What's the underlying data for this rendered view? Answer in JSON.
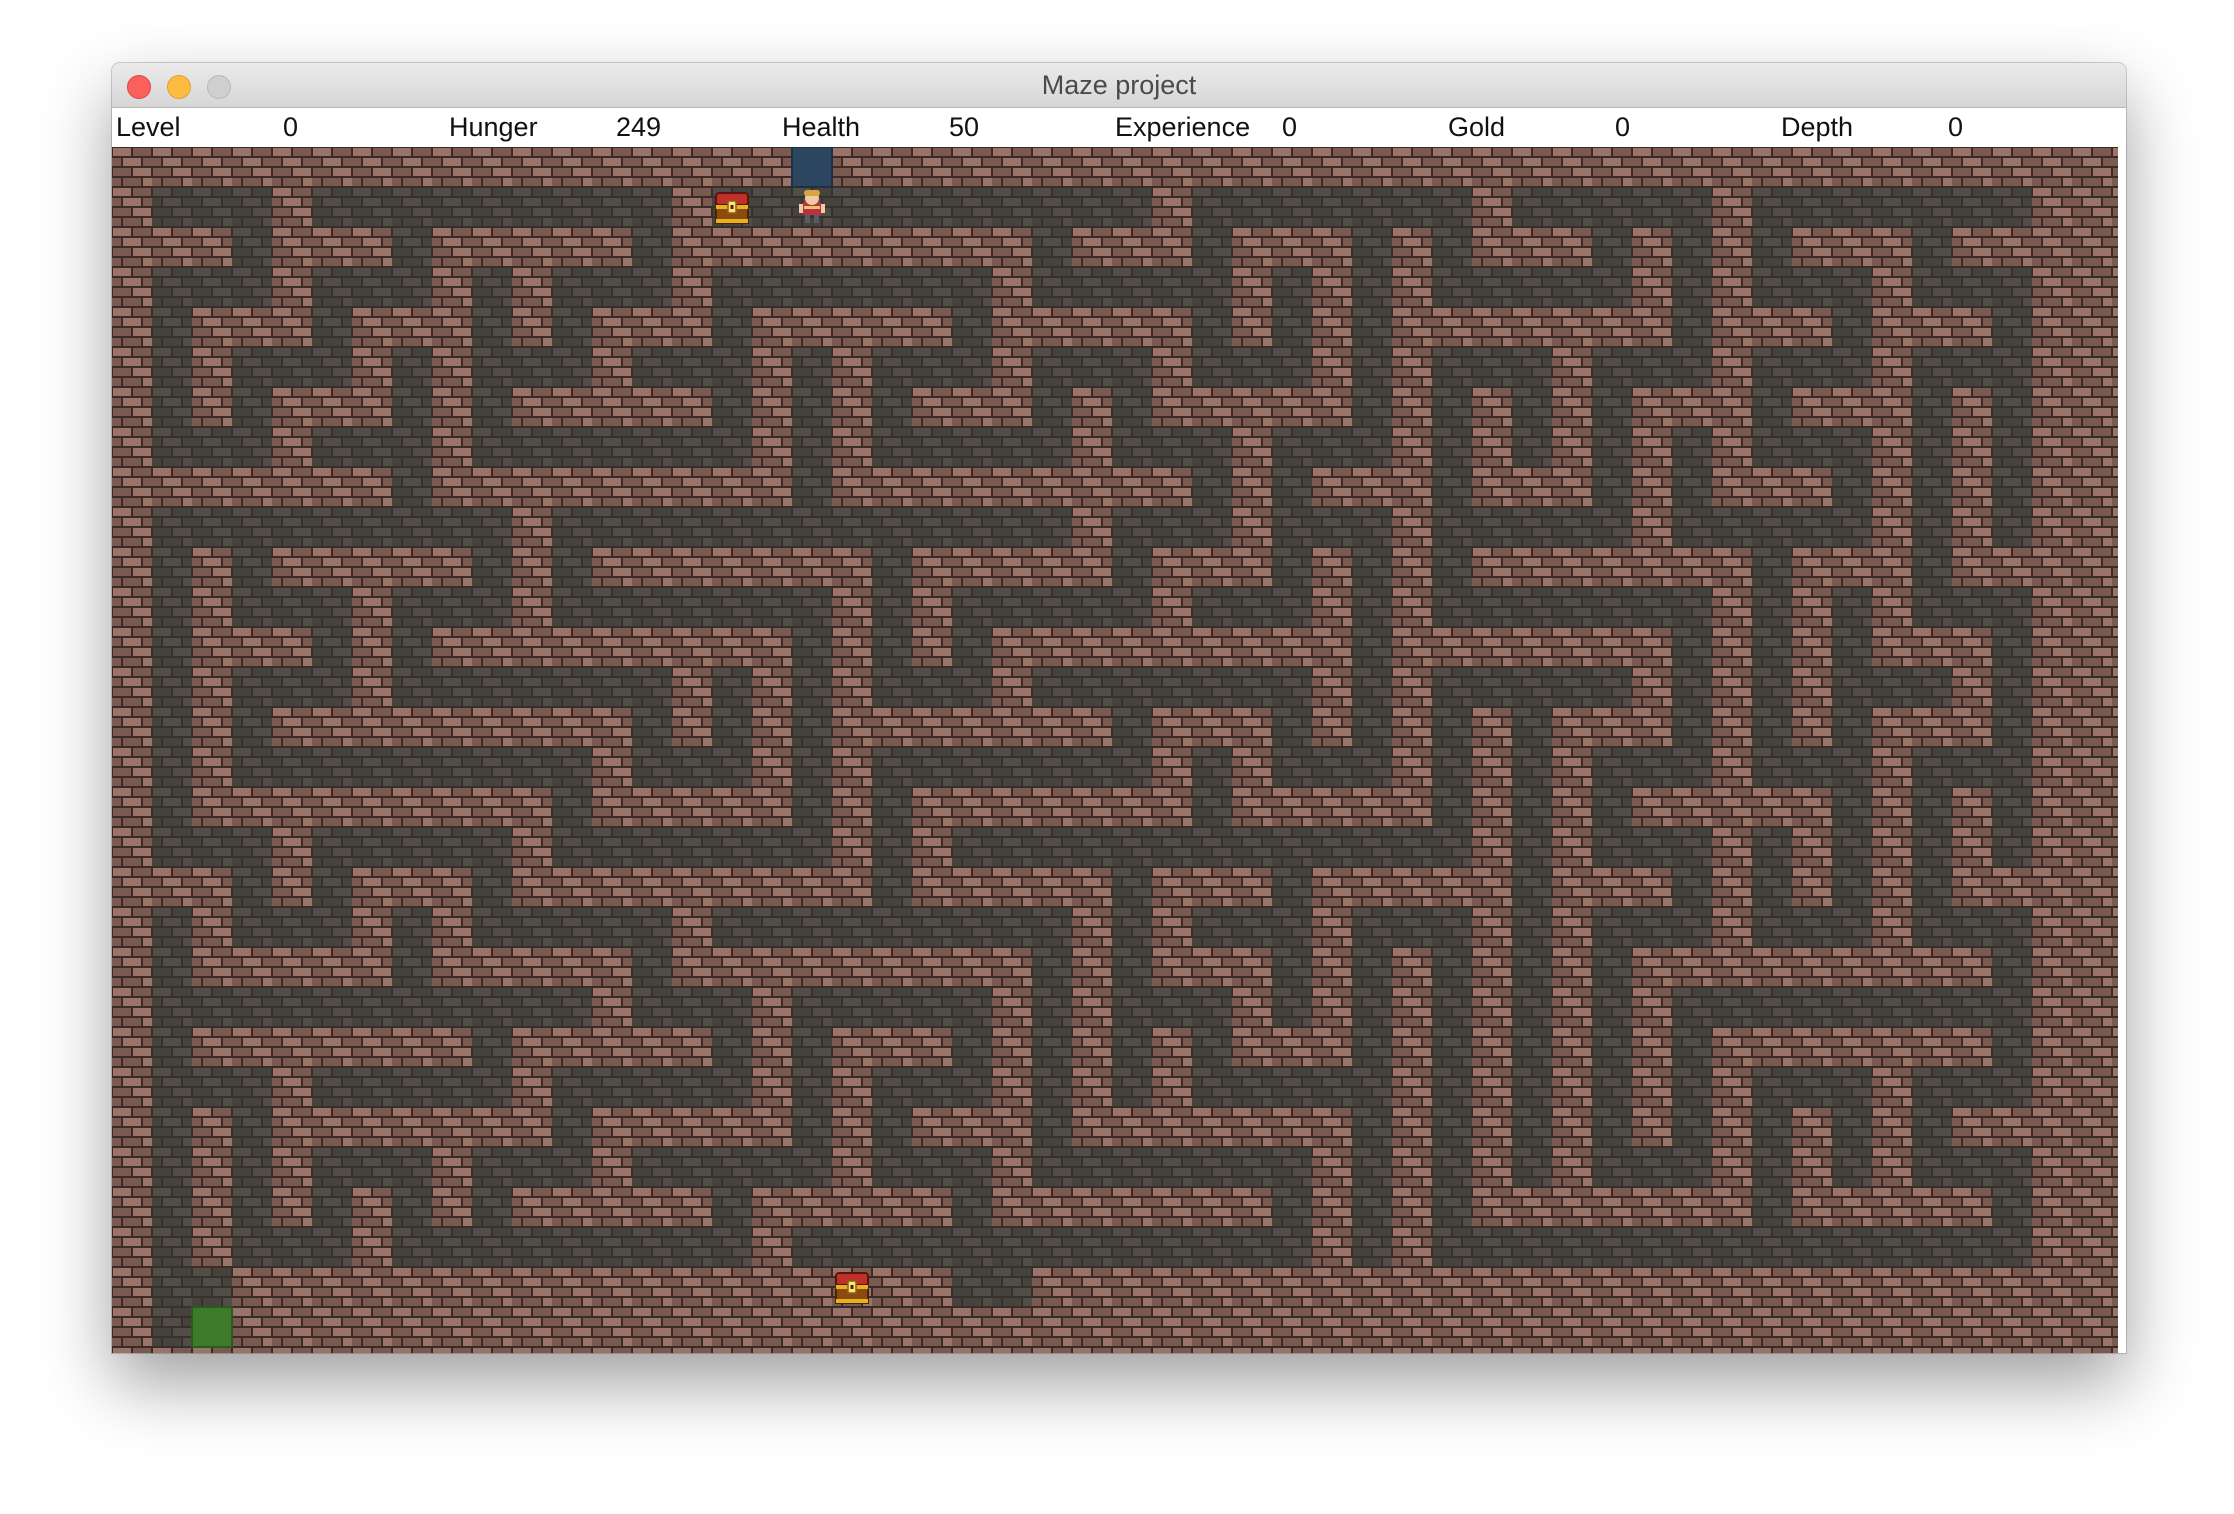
{
  "window": {
    "title": "Maze project",
    "controls": {
      "close": "close-button",
      "minimize": "minimize-button",
      "zoom": "zoom-button"
    }
  },
  "stats": [
    {
      "label": "Level",
      "value": "0"
    },
    {
      "label": "Hunger",
      "value": "249"
    },
    {
      "label": "Health",
      "value": "50"
    },
    {
      "label": "Experience",
      "value": "0"
    },
    {
      "label": "Gold",
      "value": "0"
    },
    {
      "label": "Depth",
      "value": "0"
    }
  ],
  "colors": {
    "wall": "#7a5a50",
    "wall_light": "#9a7468",
    "wall_mortar": "#3b2a26",
    "floor": "#46423c",
    "floor_brick": "#524d47",
    "floor_mortar": "#35312c",
    "entrance": "#2c4660",
    "exit": "#3d7a2a",
    "gold": "#e8b21c"
  },
  "icons": {
    "player": "player-icon",
    "chest": "treasure-chest-icon",
    "entrance": "stairs-up-tile",
    "exit": "exit-tile"
  }
}
